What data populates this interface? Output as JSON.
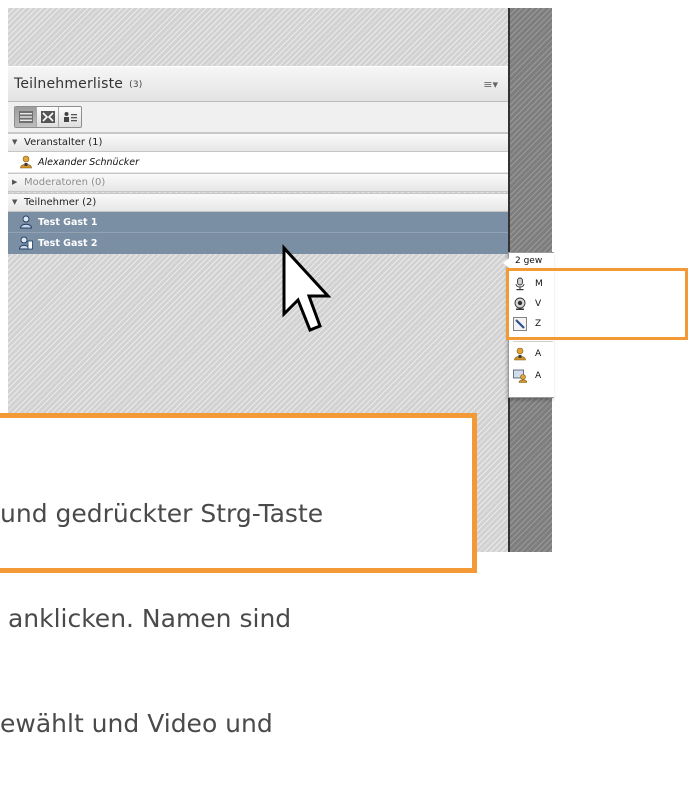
{
  "pod": {
    "title": "Teilnehmerliste",
    "count": "(3)",
    "menu_icon": "menu-icon",
    "views": [
      {
        "icon": "list-view-icon",
        "active": true
      },
      {
        "icon": "grid-view-icon",
        "active": false
      },
      {
        "icon": "attendee-view-icon",
        "active": false
      }
    ],
    "sections": [
      {
        "label": "Veranstalter (1)",
        "expanded": true
      },
      {
        "label": "Moderatoren (0)",
        "expanded": false
      },
      {
        "label": "Teilnehmer (2)",
        "expanded": true
      }
    ],
    "hosts": [
      {
        "name": "Alexander Schnücker",
        "icon": "host-user-icon"
      }
    ],
    "participants": [
      {
        "name": "Test Gast 1",
        "icon": "participant-icon",
        "selected": true
      },
      {
        "name": "Test Gast 2",
        "icon": "participant-device-icon",
        "selected": true
      }
    ]
  },
  "popup": {
    "title": "2 gew",
    "items": [
      {
        "label": "M",
        "icon": "microphone-icon"
      },
      {
        "label": "V",
        "icon": "webcam-icon"
      },
      {
        "label": "Z",
        "icon": "drawing-rights-icon"
      },
      {
        "label": "A",
        "icon": "promote-host-icon"
      },
      {
        "label": "A",
        "icon": "promote-presenter-icon"
      }
    ]
  },
  "callout": {
    "lines": [
      "und gedrückter Strg-Taste",
      " anklicken. Namen sind",
      "ewählt und Video und"
    ]
  },
  "colors": {
    "highlight": "#f39a37",
    "selection": "#7a8ea4"
  }
}
